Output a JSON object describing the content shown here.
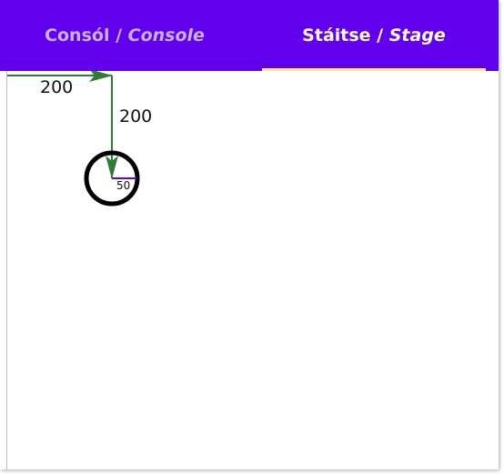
{
  "colors": {
    "tabbar": "#6200ee",
    "active_indicator": "#ffe57f",
    "inactive_tab_text": "#c7b2ff",
    "arrow": "#2e7d32",
    "radius_line": "#6200ee"
  },
  "tabs": [
    {
      "label_ga": "Consól",
      "separator": " / ",
      "label_en": "Console",
      "active": false
    },
    {
      "label_ga": "Stáitse",
      "separator": " / ",
      "label_en": "Stage",
      "active": true
    }
  ],
  "stage": {
    "x_label": "200",
    "y_label": "200",
    "radius_label": "50"
  }
}
